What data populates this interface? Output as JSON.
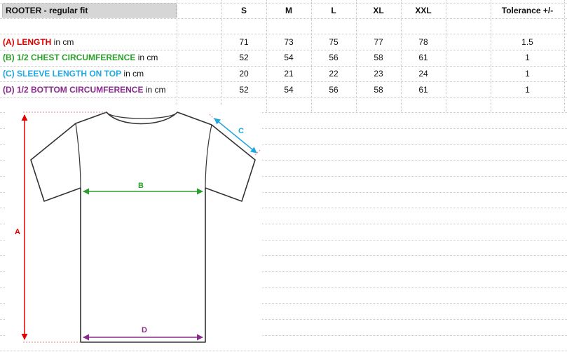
{
  "title": "ROOTER  - regular fit",
  "columns": [
    "S",
    "M",
    "L",
    "XL",
    "XXL",
    "Tolerance +/-"
  ],
  "rows": [
    {
      "key": "(A) LENGTH",
      "unit": " in cm",
      "color": "#e00000",
      "values": [
        "71",
        "73",
        "75",
        "77",
        "78"
      ],
      "tolerance": "1.5"
    },
    {
      "key": "(B) 1/2 CHEST CIRCUMFERENCE",
      "unit": " in cm",
      "color": "#2aa02a",
      "values": [
        "52",
        "54",
        "56",
        "58",
        "61"
      ],
      "tolerance": "1"
    },
    {
      "key": "(C) SLEEVE LENGTH ON TOP",
      "unit": " in cm",
      "color": "#1fa8e0",
      "values": [
        "20",
        "21",
        "22",
        "23",
        "24"
      ],
      "tolerance": "1"
    },
    {
      "key": "(D) 1/2 BOTTOM CIRCUMFERENCE",
      "unit": " in cm",
      "color": "#8a2a8e",
      "values": [
        "52",
        "54",
        "56",
        "58",
        "61"
      ],
      "tolerance": "1"
    }
  ],
  "diagram": {
    "label_a": "A",
    "label_b": "B",
    "label_c": "C",
    "label_d": "D"
  },
  "colors": {
    "a": "#e00000",
    "b": "#2aa02a",
    "c": "#1fa8e0",
    "d": "#8a2a8e",
    "header_bg": "#d6d6d6"
  }
}
